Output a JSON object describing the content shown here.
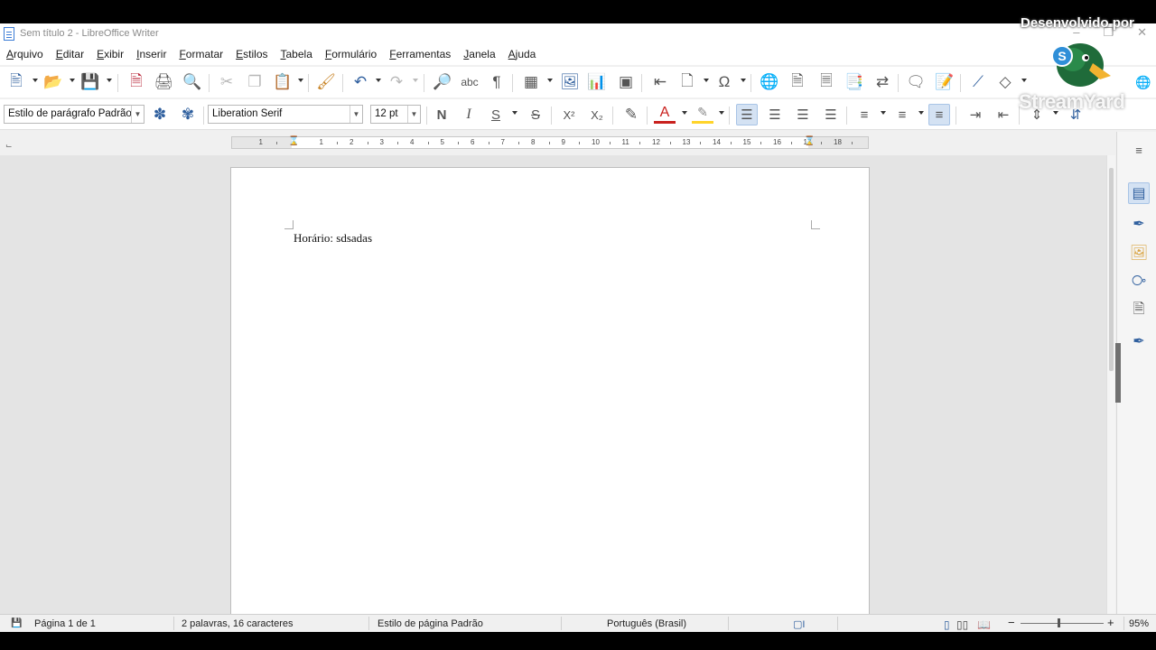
{
  "window": {
    "title": "Sem título 2 - LibreOffice Writer",
    "controls": [
      "–",
      "❐",
      "✕"
    ]
  },
  "menu": [
    "Arquivo",
    "Editar",
    "Exibir",
    "Inserir",
    "Formatar",
    "Estilos",
    "Tabela",
    "Formulário",
    "Ferramentas",
    "Janela",
    "Ajuda"
  ],
  "format_bar": {
    "paragraph_style": "Estilo de parágrafo Padrão",
    "font_name": "Liberation Serif",
    "font_size": "12 pt"
  },
  "ruler": {
    "numbers": [
      "1",
      "1",
      "2",
      "3",
      "4",
      "5",
      "6",
      "7",
      "8",
      "9",
      "10",
      "11",
      "12",
      "13",
      "14",
      "15",
      "16",
      "17",
      "18"
    ]
  },
  "document": {
    "text": "Horário: sdsadas"
  },
  "statusbar": {
    "page": "Página 1 de 1",
    "word_count": "2 palavras, 16 caracteres",
    "page_style": "Estilo de página Padrão",
    "language": "Português (Brasil)",
    "zoom": "95%"
  },
  "overlay": {
    "developed_by": "Desenvolvido por",
    "brand": "StreamYard"
  },
  "colors": {
    "accent": "#2f5f9e",
    "font_color_bar": "#c9211e",
    "highlight_bar": "#ffd42a",
    "active_button": "#d4e2f3"
  }
}
